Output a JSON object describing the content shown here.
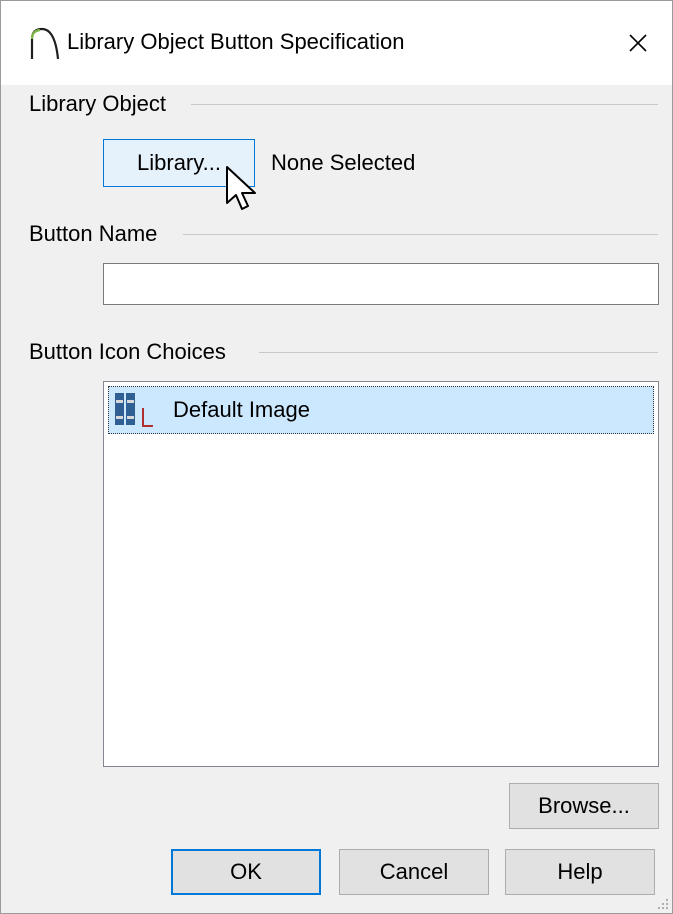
{
  "window": {
    "title": "Library Object Button Specification",
    "close_glyph": "✕"
  },
  "library_object": {
    "section_label": "Library Object",
    "library_button_label": "Library...",
    "selection_status": "None Selected"
  },
  "button_name": {
    "section_label": "Button Name",
    "value": ""
  },
  "icon_choices": {
    "section_label": "Button Icon Choices",
    "items": [
      {
        "label": "Default Image",
        "icon": "library-books-icon",
        "selected": true
      }
    ],
    "browse_label": "Browse..."
  },
  "footer": {
    "ok_label": "OK",
    "cancel_label": "Cancel",
    "help_label": "Help"
  },
  "colors": {
    "accent": "#0078d7",
    "selection": "#cce8ff"
  }
}
